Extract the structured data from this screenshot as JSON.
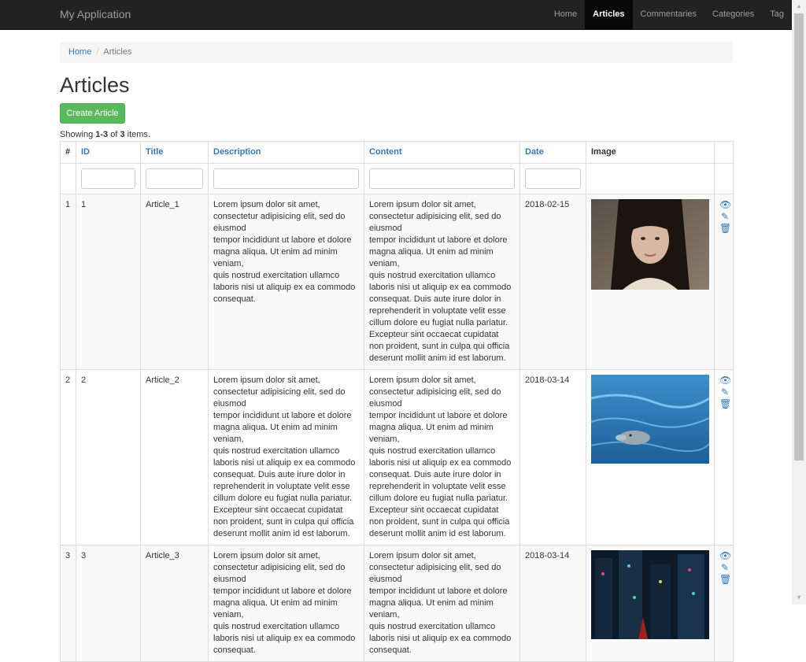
{
  "navbar": {
    "brand": "My Application",
    "items": [
      {
        "label": "Home",
        "active": false
      },
      {
        "label": "Articles",
        "active": true
      },
      {
        "label": "Commentaries",
        "active": false
      },
      {
        "label": "Categories",
        "active": false
      },
      {
        "label": "Tag",
        "active": false
      }
    ]
  },
  "breadcrumb": {
    "home": "Home",
    "separator": "/",
    "current": "Articles"
  },
  "page": {
    "title": "Articles",
    "create_label": "Create Article",
    "summary_prefix": "Showing ",
    "summary_range": "1-3",
    "summary_of": " of ",
    "summary_total": "3",
    "summary_suffix": " items."
  },
  "table": {
    "headers": {
      "num": "#",
      "id": "ID",
      "title": "Title",
      "description": "Description",
      "content": "Content",
      "date": "Date",
      "image": "Image"
    },
    "rows": [
      {
        "num": "1",
        "id": "1",
        "title": "Article_1",
        "description": "Lorem ipsum dolor sit amet, consectetur adipisicing elit, sed do eiusmod\ntempor incididunt ut labore et dolore magna aliqua. Ut enim ad minim veniam,\nquis nostrud exercitation ullamco laboris nisi ut aliquip ex ea commodo consequat.",
        "content": "Lorem ipsum dolor sit amet, consectetur adipisicing elit, sed do eiusmod\ntempor incididunt ut labore et dolore magna aliqua. Ut enim ad minim veniam,\nquis nostrud exercitation ullamco laboris nisi ut aliquip ex ea commodo consequat. Duis aute irure dolor in reprehenderit in voluptate velit esse cillum dolore eu fugiat nulla pariatur. Excepteur sint occaecat cupidatat non proident, sunt in culpa qui officia deserunt mollit anim id est laborum.",
        "date": "2018-02-15",
        "image": "portrait-photo"
      },
      {
        "num": "2",
        "id": "2",
        "title": "Article_2",
        "description": "Lorem ipsum dolor sit amet, consectetur adipisicing elit, sed do eiusmod\ntempor incididunt ut labore et dolore magna aliqua. Ut enim ad minim veniam,\nquis nostrud exercitation ullamco laboris nisi ut aliquip ex ea commodo consequat. Duis aute irure dolor in reprehenderit in voluptate velit esse cillum dolore eu fugiat nulla pariatur. Excepteur sint occaecat cupidatat non proident, sunt in culpa qui officia deserunt mollit anim id est laborum.",
        "content": "Lorem ipsum dolor sit amet, consectetur adipisicing elit, sed do eiusmod\ntempor incididunt ut labore et dolore magna aliqua. Ut enim ad minim veniam,\nquis nostrud exercitation ullamco laboris nisi ut aliquip ex ea commodo consequat. Duis aute irure dolor in reprehenderit in voluptate velit esse cillum dolore eu fugiat nulla pariatur. Excepteur sint occaecat cupidatat non proident, sunt in culpa qui officia deserunt mollit anim id est laborum.",
        "date": "2018-03-14",
        "image": "dolphin-photo"
      },
      {
        "num": "3",
        "id": "3",
        "title": "Article_3",
        "description": "Lorem ipsum dolor sit amet, consectetur adipisicing elit, sed do eiusmod\ntempor incididunt ut labore et dolore magna aliqua. Ut enim ad minim veniam,\nquis nostrud exercitation ullamco laboris nisi ut aliquip ex ea commodo consequat.",
        "content": "Lorem ipsum dolor sit amet, consectetur adipisicing elit, sed do eiusmod\ntempor incididunt ut labore et dolore magna aliqua. Ut enim ad minim veniam,\nquis nostrud exercitation ullamco laboris nisi ut aliquip ex ea commodo consequat.",
        "date": "2018-03-14",
        "image": "city-night-photo"
      }
    ]
  },
  "icons": {
    "view": "eye-icon",
    "update": "pencil-icon",
    "delete": "trash-icon"
  },
  "colors": {
    "navbar": "#222222",
    "navbar_active": "#080808",
    "link": "#337ab7",
    "success": "#5cb85c",
    "stripe": "#f9f9f9"
  }
}
